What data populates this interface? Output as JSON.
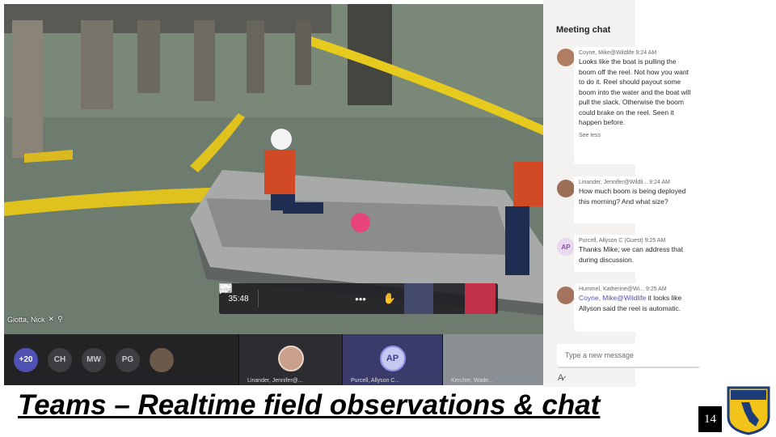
{
  "meeting": {
    "timer": "35:48",
    "main_participant": "Giotta, Nick",
    "toolbar": {
      "camera_icon": "camera-off-icon",
      "mic_icon": "mic-off-icon",
      "share_icon": "share-screen-icon",
      "more_icon": "more-options-icon",
      "raise_hand_icon": "raise-hand-icon",
      "chat_icon": "chat-icon",
      "participants_icon": "participants-icon",
      "hangup_icon": "hang-up-icon",
      "hangup_color": "#c4314b"
    },
    "strip": {
      "overflow_count": "+20",
      "initials": [
        "CH",
        "MW",
        "PG"
      ],
      "tiles": [
        {
          "label": "Linander, Jennifer@..."
        },
        {
          "label": "Purcell, Allyson C...",
          "initials": "AP"
        },
        {
          "label": "Kercher, Wade..."
        }
      ]
    }
  },
  "chat": {
    "title": "Meeting chat",
    "messages": [
      {
        "author": "Coyne, Mike@Wildlife",
        "time": "9:24 AM",
        "text": "Looks like the boat is pulling the boom off the reel. Not how you want to do it. Reel should payout some boom into the water and the boat will pull the slack. Otherwise the boom could brake on the reel. Seen it happen before.",
        "toggle": "See less"
      },
      {
        "author": "Linander, Jennifer@Wildli...",
        "time": "9:24 AM",
        "text": "How much boom is being deployed this morning? And what size?"
      },
      {
        "author": "Purcell, Allyson C (Guest)",
        "time": "9:25 AM",
        "avatar_initials": "AP",
        "text": "Thanks Mike; we can address that during discussion."
      },
      {
        "author": "Hummel, Katherine@Wi...",
        "time": "9:25 AM",
        "mention": "Coyne, Mike@Wildlife",
        "text": " it looks like Allyson said the reel is automatic."
      }
    ],
    "compose_placeholder": "Type a new message",
    "format_icon": "format-icon"
  },
  "slide": {
    "caption": "Teams – Realtime field observations & chat",
    "page_number": "14",
    "logo_icon": "california-fish-and-wildlife-logo"
  }
}
